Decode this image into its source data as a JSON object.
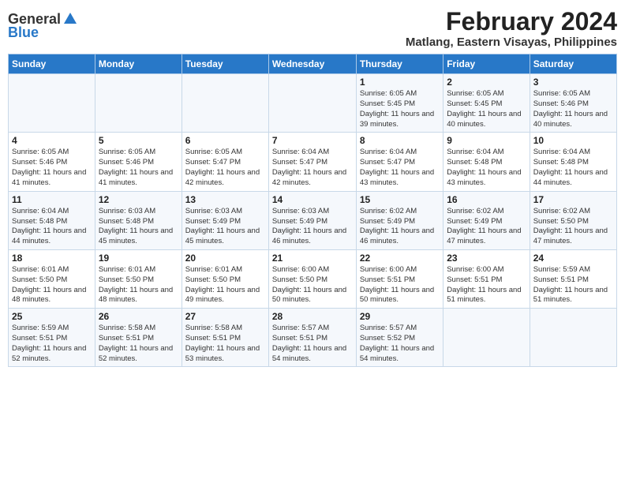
{
  "header": {
    "logo_general": "General",
    "logo_blue": "Blue",
    "title": "February 2024",
    "subtitle": "Matlang, Eastern Visayas, Philippines"
  },
  "columns": [
    "Sunday",
    "Monday",
    "Tuesday",
    "Wednesday",
    "Thursday",
    "Friday",
    "Saturday"
  ],
  "weeks": [
    [
      {
        "day": "",
        "info": ""
      },
      {
        "day": "",
        "info": ""
      },
      {
        "day": "",
        "info": ""
      },
      {
        "day": "",
        "info": ""
      },
      {
        "day": "1",
        "info": "Sunrise: 6:05 AM\nSunset: 5:45 PM\nDaylight: 11 hours and 39 minutes."
      },
      {
        "day": "2",
        "info": "Sunrise: 6:05 AM\nSunset: 5:45 PM\nDaylight: 11 hours and 40 minutes."
      },
      {
        "day": "3",
        "info": "Sunrise: 6:05 AM\nSunset: 5:46 PM\nDaylight: 11 hours and 40 minutes."
      }
    ],
    [
      {
        "day": "4",
        "info": "Sunrise: 6:05 AM\nSunset: 5:46 PM\nDaylight: 11 hours and 41 minutes."
      },
      {
        "day": "5",
        "info": "Sunrise: 6:05 AM\nSunset: 5:46 PM\nDaylight: 11 hours and 41 minutes."
      },
      {
        "day": "6",
        "info": "Sunrise: 6:05 AM\nSunset: 5:47 PM\nDaylight: 11 hours and 42 minutes."
      },
      {
        "day": "7",
        "info": "Sunrise: 6:04 AM\nSunset: 5:47 PM\nDaylight: 11 hours and 42 minutes."
      },
      {
        "day": "8",
        "info": "Sunrise: 6:04 AM\nSunset: 5:47 PM\nDaylight: 11 hours and 43 minutes."
      },
      {
        "day": "9",
        "info": "Sunrise: 6:04 AM\nSunset: 5:48 PM\nDaylight: 11 hours and 43 minutes."
      },
      {
        "day": "10",
        "info": "Sunrise: 6:04 AM\nSunset: 5:48 PM\nDaylight: 11 hours and 44 minutes."
      }
    ],
    [
      {
        "day": "11",
        "info": "Sunrise: 6:04 AM\nSunset: 5:48 PM\nDaylight: 11 hours and 44 minutes."
      },
      {
        "day": "12",
        "info": "Sunrise: 6:03 AM\nSunset: 5:48 PM\nDaylight: 11 hours and 45 minutes."
      },
      {
        "day": "13",
        "info": "Sunrise: 6:03 AM\nSunset: 5:49 PM\nDaylight: 11 hours and 45 minutes."
      },
      {
        "day": "14",
        "info": "Sunrise: 6:03 AM\nSunset: 5:49 PM\nDaylight: 11 hours and 46 minutes."
      },
      {
        "day": "15",
        "info": "Sunrise: 6:02 AM\nSunset: 5:49 PM\nDaylight: 11 hours and 46 minutes."
      },
      {
        "day": "16",
        "info": "Sunrise: 6:02 AM\nSunset: 5:49 PM\nDaylight: 11 hours and 47 minutes."
      },
      {
        "day": "17",
        "info": "Sunrise: 6:02 AM\nSunset: 5:50 PM\nDaylight: 11 hours and 47 minutes."
      }
    ],
    [
      {
        "day": "18",
        "info": "Sunrise: 6:01 AM\nSunset: 5:50 PM\nDaylight: 11 hours and 48 minutes."
      },
      {
        "day": "19",
        "info": "Sunrise: 6:01 AM\nSunset: 5:50 PM\nDaylight: 11 hours and 48 minutes."
      },
      {
        "day": "20",
        "info": "Sunrise: 6:01 AM\nSunset: 5:50 PM\nDaylight: 11 hours and 49 minutes."
      },
      {
        "day": "21",
        "info": "Sunrise: 6:00 AM\nSunset: 5:50 PM\nDaylight: 11 hours and 50 minutes."
      },
      {
        "day": "22",
        "info": "Sunrise: 6:00 AM\nSunset: 5:51 PM\nDaylight: 11 hours and 50 minutes."
      },
      {
        "day": "23",
        "info": "Sunrise: 6:00 AM\nSunset: 5:51 PM\nDaylight: 11 hours and 51 minutes."
      },
      {
        "day": "24",
        "info": "Sunrise: 5:59 AM\nSunset: 5:51 PM\nDaylight: 11 hours and 51 minutes."
      }
    ],
    [
      {
        "day": "25",
        "info": "Sunrise: 5:59 AM\nSunset: 5:51 PM\nDaylight: 11 hours and 52 minutes."
      },
      {
        "day": "26",
        "info": "Sunrise: 5:58 AM\nSunset: 5:51 PM\nDaylight: 11 hours and 52 minutes."
      },
      {
        "day": "27",
        "info": "Sunrise: 5:58 AM\nSunset: 5:51 PM\nDaylight: 11 hours and 53 minutes."
      },
      {
        "day": "28",
        "info": "Sunrise: 5:57 AM\nSunset: 5:51 PM\nDaylight: 11 hours and 54 minutes."
      },
      {
        "day": "29",
        "info": "Sunrise: 5:57 AM\nSunset: 5:52 PM\nDaylight: 11 hours and 54 minutes."
      },
      {
        "day": "",
        "info": ""
      },
      {
        "day": "",
        "info": ""
      }
    ]
  ]
}
